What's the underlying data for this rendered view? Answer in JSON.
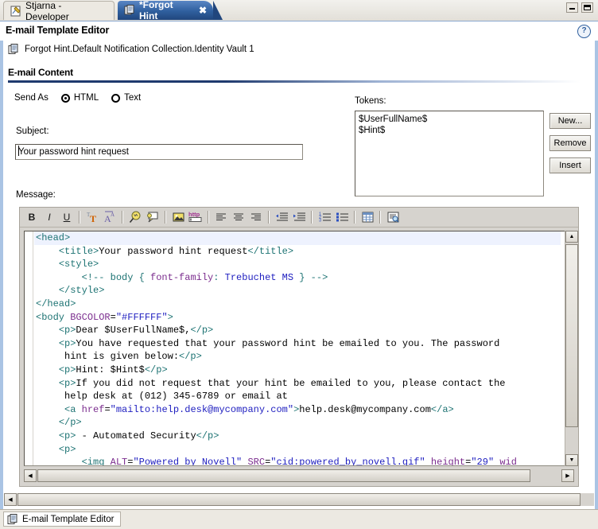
{
  "window": {
    "tabs": [
      {
        "label": "Stjarna - Developer",
        "icon": "editor-doc-icon",
        "active": false
      },
      {
        "label": "*Forgot Hint",
        "icon": "template-doc-icon",
        "active": true,
        "close": "✖"
      }
    ],
    "controls": {
      "minimize": "minimize-button",
      "maximize": "maximize-button"
    }
  },
  "header": {
    "title": "E-mail Template Editor",
    "help": "?",
    "breadcrumb": "Forgot Hint.Default Notification Collection.Identity Vault 1"
  },
  "section": {
    "title": "E-mail Content"
  },
  "form": {
    "send_as_label": "Send As",
    "options": [
      {
        "label": "HTML",
        "selected": true
      },
      {
        "label": "Text",
        "selected": false
      }
    ],
    "subject_label": "Subject:",
    "subject_value": "Your password hint request",
    "message_label": "Message:"
  },
  "tokens": {
    "label": "Tokens:",
    "items": [
      "$UserFullName$",
      "$Hint$"
    ],
    "buttons": [
      "New...",
      "Remove",
      "Insert"
    ]
  },
  "toolbar": {
    "buttons": [
      {
        "name": "bold-icon",
        "glyph": "B"
      },
      {
        "name": "italic-icon",
        "glyph": "I"
      },
      {
        "name": "underline-icon",
        "glyph": "U"
      },
      {
        "name": "font-color-icon",
        "glyph": "T"
      },
      {
        "name": "font-style-icon",
        "glyph": "A"
      },
      {
        "name": "find-icon",
        "glyph": "⌕"
      },
      {
        "name": "spellcheck-icon",
        "glyph": "▭"
      },
      {
        "name": "insert-image-icon",
        "glyph": "◰"
      },
      {
        "name": "insert-link-icon",
        "glyph": "http"
      },
      {
        "name": "align-left-icon",
        "glyph": "≡"
      },
      {
        "name": "align-center-icon",
        "glyph": "≡"
      },
      {
        "name": "align-right-icon",
        "glyph": "≡"
      },
      {
        "name": "outdent-icon",
        "glyph": "⇤"
      },
      {
        "name": "indent-icon",
        "glyph": "⇥"
      },
      {
        "name": "ordered-list-icon",
        "glyph": "≣"
      },
      {
        "name": "bullet-list-icon",
        "glyph": "≣"
      },
      {
        "name": "insert-table-icon",
        "glyph": "▦"
      },
      {
        "name": "source-view-icon",
        "glyph": "❐"
      }
    ]
  },
  "editor": {
    "lines": [
      {
        "cur": true,
        "html": "<span class='tag'>&lt;head&gt;</span>"
      },
      {
        "cur": false,
        "html": "    <span class='tag'>&lt;title&gt;</span>Your password hint request<span class='tag'>&lt;/title&gt;</span>"
      },
      {
        "cur": false,
        "html": "    <span class='tag'>&lt;style&gt;</span>"
      },
      {
        "cur": false,
        "html": "        <span class='cmt'>&lt;!-- body { </span><span class='attr'>font-family</span><span class='cmt'>: </span><span class='val'>Trebuchet MS</span><span class='cmt'> } --&gt;</span>"
      },
      {
        "cur": false,
        "html": "    <span class='tag'>&lt;/style&gt;</span>"
      },
      {
        "cur": false,
        "html": "<span class='tag'>&lt;/head&gt;</span>"
      },
      {
        "cur": false,
        "html": "<span class='tag'>&lt;body </span><span class='attr'>BGCOLOR</span>=<span class='val'>\"#FFFFFF\"</span><span class='tag'>&gt;</span>"
      },
      {
        "cur": false,
        "html": "    <span class='tag'>&lt;p&gt;</span>Dear $UserFullName$,<span class='tag'>&lt;/p&gt;</span>"
      },
      {
        "cur": false,
        "html": "    <span class='tag'>&lt;p&gt;</span>You have requested that your password hint be emailed to you. The password"
      },
      {
        "cur": false,
        "html": "     hint is given below:<span class='tag'>&lt;/p&gt;</span>"
      },
      {
        "cur": false,
        "html": "    <span class='tag'>&lt;p&gt;</span>Hint: $Hint$<span class='tag'>&lt;/p&gt;</span>"
      },
      {
        "cur": false,
        "html": "    <span class='tag'>&lt;p&gt;</span>If you did not request that your hint be emailed to you, please contact the"
      },
      {
        "cur": false,
        "html": "     help desk at (012) 345-6789 or email at"
      },
      {
        "cur": false,
        "html": "     <span class='tag'>&lt;a </span><span class='attr'>href</span>=<span class='val'>\"mailto:help.desk@mycompany.com\"</span><span class='tag'>&gt;</span>help.desk@mycompany.com<span class='tag'>&lt;/a&gt;</span>"
      },
      {
        "cur": false,
        "html": "    <span class='tag'>&lt;/p&gt;</span>"
      },
      {
        "cur": false,
        "html": "    <span class='tag'>&lt;p&gt;</span> - Automated Security<span class='tag'>&lt;/p&gt;</span>"
      },
      {
        "cur": false,
        "html": "    <span class='tag'>&lt;p&gt;</span>"
      },
      {
        "cur": false,
        "html": "        <span class='tag'>&lt;img </span><span class='attr'>ALT</span>=<span class='val'>\"Powered by Novell\"</span> <span class='attr'>SRC</span>=<span class='val'>\"cid:powered_by_novell.gif\"</span> <span class='attr'>height</span>=<span class='val'>\"29\"</span> <span class='attr'>wid</span>"
      }
    ]
  },
  "taskbar": {
    "item": "E-mail Template Editor"
  },
  "colors": {
    "accent": "#2f5f9e",
    "rule": "#1f3a6e",
    "chrome": "#d6d3ce",
    "tag": "#1d7373",
    "attr": "#7b2d8e",
    "value": "#2020c0",
    "current_line": "#eef2fe"
  }
}
